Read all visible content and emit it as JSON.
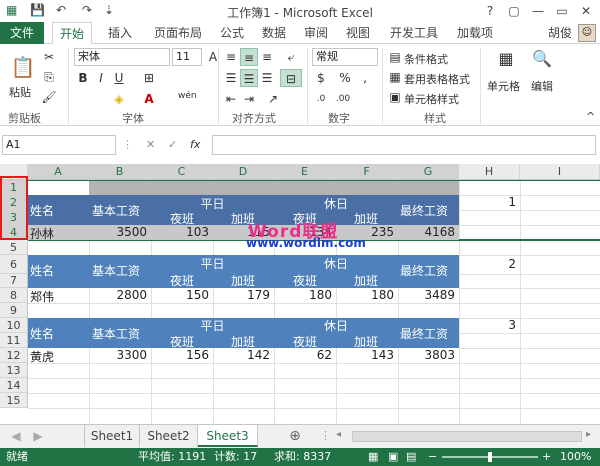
{
  "title": "工作簿1 - Microsoft Excel",
  "window_controls": [
    "?",
    "▢",
    "—",
    "▭",
    "✕"
  ],
  "quick_access": [
    "💾",
    "↶",
    "↷",
    "⇣"
  ],
  "tabs": {
    "file": "文件",
    "items": [
      "开始",
      "插入",
      "页面布局",
      "公式",
      "数据",
      "审阅",
      "视图",
      "开发工具",
      "加载项"
    ],
    "user": "胡俊"
  },
  "ribbon": {
    "paste": "粘贴",
    "clipboard": "剪贴板",
    "font_name": "宋体",
    "font_size": "11",
    "bold": "B",
    "italic": "I",
    "underline": "U",
    "font_group": "字体",
    "wen": "wén",
    "align_group": "对齐方式",
    "number_format": "常规",
    "number_group": "数字",
    "cond_format": "条件格式",
    "table_format": "套用表格格式",
    "cell_style": "单元格样式",
    "styles_group": "样式",
    "cells": "单元格",
    "edit": "编辑"
  },
  "formula_bar": {
    "name_box": "A1",
    "fx": "fx",
    "cancel": "✕",
    "enter": "✓",
    "value": ""
  },
  "columns": [
    "A",
    "B",
    "C",
    "D",
    "E",
    "F",
    "G",
    "H",
    "I"
  ],
  "rows": [
    "1",
    "2",
    "3",
    "4",
    "5",
    "6",
    "7",
    "8",
    "9",
    "10",
    "11",
    "12",
    "13",
    "14",
    "15"
  ],
  "tables": [
    {
      "header": {
        "name": "姓名",
        "base": "基本工资",
        "weekday": "平日",
        "holiday": "休日",
        "final": "最终工资",
        "night": "夜班",
        "overtime": "加班"
      },
      "row": {
        "name": "孙林",
        "base": "3500",
        "wd_night": "103",
        "wd_ot": "115",
        "hd_night": "134",
        "hd_ot": "235",
        "final": "4168"
      },
      "marker": "1"
    },
    {
      "header": {
        "name": "姓名",
        "base": "基本工资",
        "weekday": "平日",
        "holiday": "休日",
        "final": "最终工资",
        "night": "夜班",
        "overtime": "加班"
      },
      "row": {
        "name": "郑伟",
        "base": "2800",
        "wd_night": "150",
        "wd_ot": "179",
        "hd_night": "180",
        "hd_ot": "180",
        "final": "3489"
      },
      "marker": "2"
    },
    {
      "header": {
        "name": "姓名",
        "base": "基本工资",
        "weekday": "平日",
        "holiday": "休日",
        "final": "最终工资",
        "night": "夜班",
        "overtime": "加班"
      },
      "row": {
        "name": "黄虎",
        "base": "3300",
        "wd_night": "156",
        "wd_ot": "142",
        "hd_night": "62",
        "hd_ot": "143",
        "final": "3803"
      },
      "marker": "3"
    }
  ],
  "watermark": {
    "logo": "Word联盟",
    "url": "www.wordlm.com"
  },
  "sheets": [
    "Sheet1",
    "Sheet2",
    "Sheet3"
  ],
  "add_sheet": "⊕",
  "status": {
    "ready": "就绪",
    "average": "平均值: 1191",
    "count": "计数: 17",
    "sum": "求和: 8337",
    "zoom": "100%"
  },
  "colors": {
    "accent": "#217346",
    "table_header": "#4f81bd",
    "selection_box": "#e21b1b"
  }
}
